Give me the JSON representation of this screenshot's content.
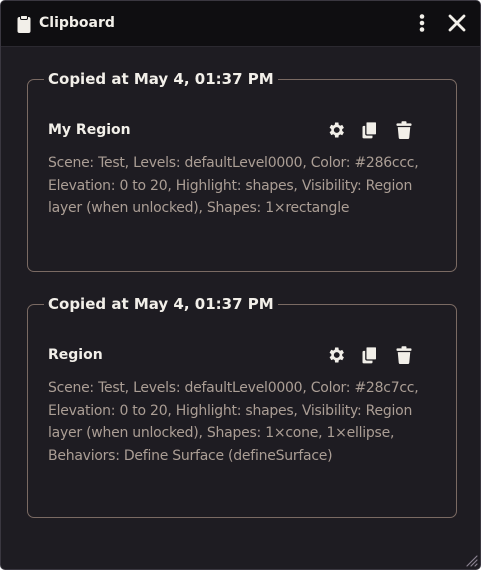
{
  "window": {
    "title": "Clipboard",
    "icons": {
      "title": "clipboard-icon",
      "menu": "kebab-menu-icon",
      "close": "close-icon",
      "resize": "resize-handle-icon"
    }
  },
  "colors": {
    "window_bg": "#1e1c22",
    "titlebar_bg": "#0f0e11",
    "text_primary": "#f2efe9",
    "text_muted": "#ab9e95",
    "entry_border": "#7a6a63"
  },
  "entries": [
    {
      "copied_label": "Copied at May 4, 01:37 PM",
      "name": "My Region",
      "description": "Scene: Test, Levels: defaultLevel0000, Color: #286ccc, Elevation: 0 to 20, Highlight: shapes, Visibility: Region layer (when unlocked), Shapes: 1×rectangle",
      "actions": [
        "gear-icon",
        "copy-icon",
        "trash-icon"
      ]
    },
    {
      "copied_label": "Copied at May 4, 01:37 PM",
      "name": "Region",
      "description": "Scene: Test, Levels: defaultLevel0000, Color: #28c7cc, Elevation: 0 to 20, Highlight: shapes, Visibility: Region layer (when unlocked), Shapes: 1×cone, 1×ellipse, Behaviors: Define Surface (defineSurface)",
      "actions": [
        "gear-icon",
        "copy-icon",
        "trash-icon"
      ]
    }
  ]
}
